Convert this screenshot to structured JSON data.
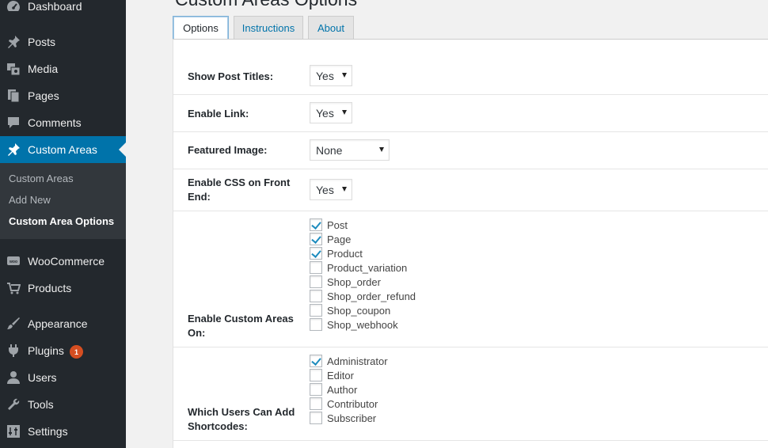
{
  "sidebar": {
    "items": [
      {
        "label": "Dashboard",
        "icon": "dashboard-icon"
      },
      {
        "label": "Posts",
        "icon": "pin-icon"
      },
      {
        "label": "Media",
        "icon": "media-icon"
      },
      {
        "label": "Pages",
        "icon": "pages-icon"
      },
      {
        "label": "Comments",
        "icon": "comment-icon"
      },
      {
        "label": "Custom Areas",
        "icon": "pin-icon"
      },
      {
        "label": "WooCommerce",
        "icon": "woo-icon"
      },
      {
        "label": "Products",
        "icon": "cart-icon"
      },
      {
        "label": "Appearance",
        "icon": "brush-icon"
      },
      {
        "label": "Plugins",
        "icon": "plugin-icon",
        "badge": "1"
      },
      {
        "label": "Users",
        "icon": "user-icon"
      },
      {
        "label": "Tools",
        "icon": "wrench-icon"
      },
      {
        "label": "Settings",
        "icon": "settings-icon"
      }
    ],
    "submenu": [
      "Custom Areas",
      "Add New",
      "Custom Area Options"
    ]
  },
  "page": {
    "title": "Custom Areas Options"
  },
  "tabs": [
    "Options",
    "Instructions",
    "About"
  ],
  "options": {
    "show_post_titles": {
      "label": "Show Post Titles:",
      "value": "Yes"
    },
    "enable_link": {
      "label": "Enable Link:",
      "value": "Yes"
    },
    "featured_image": {
      "label": "Featured Image:",
      "value": "None"
    },
    "enable_css": {
      "label_line1": "Enable CSS on Front",
      "label_line2": "End:",
      "value": "Yes"
    },
    "enable_on": {
      "label_line1": "Enable Custom Areas",
      "label_line2": "On:",
      "items": [
        {
          "label": "Post",
          "checked": true
        },
        {
          "label": "Page",
          "checked": true
        },
        {
          "label": "Product",
          "checked": true
        },
        {
          "label": "Product_variation",
          "checked": false
        },
        {
          "label": "Shop_order",
          "checked": false
        },
        {
          "label": "Shop_order_refund",
          "checked": false
        },
        {
          "label": "Shop_coupon",
          "checked": false
        },
        {
          "label": "Shop_webhook",
          "checked": false
        }
      ]
    },
    "users": {
      "label_line1": "Which Users Can Add",
      "label_line2": "Shortcodes:",
      "items": [
        {
          "label": "Administrator",
          "checked": true
        },
        {
          "label": "Editor",
          "checked": false
        },
        {
          "label": "Author",
          "checked": false
        },
        {
          "label": "Contributor",
          "checked": false
        },
        {
          "label": "Subscriber",
          "checked": false
        }
      ]
    }
  },
  "colors": {
    "sidebar_bg": "#23282d",
    "active_bg": "#0073aa",
    "badge": "#d54e21",
    "check": "#1e8cbe"
  }
}
